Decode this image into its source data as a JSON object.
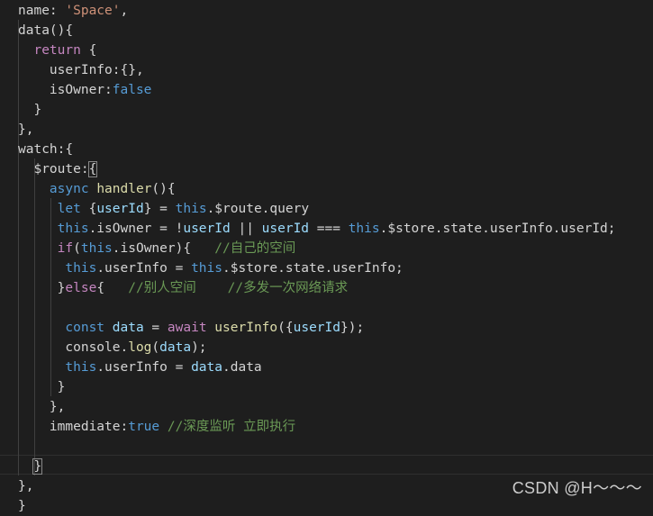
{
  "watermark": "CSDN @H～～～",
  "code": [
    [
      {
        "t": "name: "
      },
      {
        "t": "'Space'",
        "c": "s"
      },
      {
        "t": ","
      }
    ],
    [
      {
        "t": "data(){"
      }
    ],
    [
      {
        "t": "  "
      },
      {
        "t": "return",
        "c": "c"
      },
      {
        "t": " {"
      }
    ],
    [
      {
        "t": "    userInfo:{},"
      }
    ],
    [
      {
        "t": "    isOwner:"
      },
      {
        "t": "false",
        "c": "k"
      }
    ],
    [
      {
        "t": "  }"
      }
    ],
    [
      {
        "t": "},"
      }
    ],
    [
      {
        "t": "watch:{"
      }
    ],
    [
      {
        "t": "  $route:"
      },
      {
        "t": "{",
        "c": "br"
      }
    ],
    [
      {
        "t": "    "
      },
      {
        "t": "async",
        "c": "k"
      },
      {
        "t": " "
      },
      {
        "t": "handler",
        "c": "f"
      },
      {
        "t": "(){"
      }
    ],
    [
      {
        "t": "     "
      },
      {
        "t": "let",
        "c": "k"
      },
      {
        "t": " {"
      },
      {
        "t": "userId",
        "c": "p"
      },
      {
        "t": "} = "
      },
      {
        "t": "this",
        "c": "k"
      },
      {
        "t": ".$route.query"
      }
    ],
    [
      {
        "t": "     "
      },
      {
        "t": "this",
        "c": "k"
      },
      {
        "t": ".isOwner = !"
      },
      {
        "t": "userId",
        "c": "p"
      },
      {
        "t": " || "
      },
      {
        "t": "userId",
        "c": "p"
      },
      {
        "t": " === "
      },
      {
        "t": "this",
        "c": "k"
      },
      {
        "t": ".$store.state.userInfo.userId;"
      }
    ],
    [
      {
        "t": "     "
      },
      {
        "t": "if",
        "c": "c"
      },
      {
        "t": "("
      },
      {
        "t": "this",
        "c": "k"
      },
      {
        "t": ".isOwner){   "
      },
      {
        "t": "//自己的空间",
        "c": "cm"
      }
    ],
    [
      {
        "t": "      "
      },
      {
        "t": "this",
        "c": "k"
      },
      {
        "t": ".userInfo = "
      },
      {
        "t": "this",
        "c": "k"
      },
      {
        "t": ".$store.state.userInfo;"
      }
    ],
    [
      {
        "t": "     }"
      },
      {
        "t": "else",
        "c": "c"
      },
      {
        "t": "{   "
      },
      {
        "t": "//别人空间    //多发一次网络请求",
        "c": "cm"
      }
    ],
    [
      {
        "t": ""
      }
    ],
    [
      {
        "t": "      "
      },
      {
        "t": "const",
        "c": "k"
      },
      {
        "t": " "
      },
      {
        "t": "data",
        "c": "p"
      },
      {
        "t": " = "
      },
      {
        "t": "await",
        "c": "c"
      },
      {
        "t": " "
      },
      {
        "t": "userInfo",
        "c": "f"
      },
      {
        "t": "({"
      },
      {
        "t": "userId",
        "c": "p"
      },
      {
        "t": "});"
      }
    ],
    [
      {
        "t": "      console."
      },
      {
        "t": "log",
        "c": "f"
      },
      {
        "t": "("
      },
      {
        "t": "data",
        "c": "p"
      },
      {
        "t": ");"
      }
    ],
    [
      {
        "t": "      "
      },
      {
        "t": "this",
        "c": "k"
      },
      {
        "t": ".userInfo = "
      },
      {
        "t": "data",
        "c": "p"
      },
      {
        "t": ".data"
      }
    ],
    [
      {
        "t": "     }"
      }
    ],
    [
      {
        "t": "    },"
      }
    ],
    [
      {
        "t": "    immediate:"
      },
      {
        "t": "true",
        "c": "k"
      },
      {
        "t": " "
      },
      {
        "t": "//深度监听 立即执行",
        "c": "cm"
      }
    ],
    [
      {
        "t": ""
      }
    ],
    [
      {
        "t": "  "
      },
      {
        "t": "}",
        "c": "br"
      }
    ],
    [
      {
        "t": "},"
      }
    ],
    [
      {
        "t": "}"
      }
    ]
  ]
}
